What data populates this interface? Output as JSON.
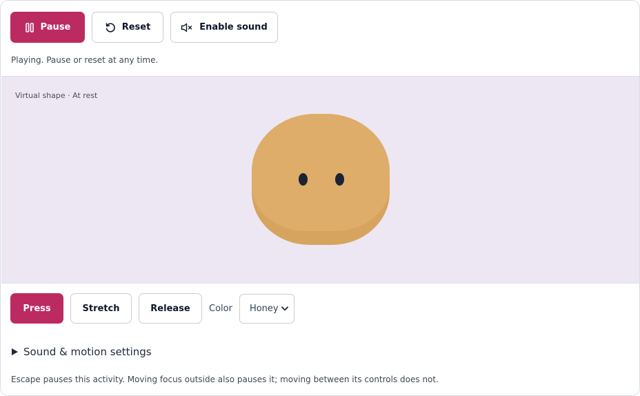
{
  "toolbar": {
    "pause_label": "Pause",
    "reset_label": "Reset",
    "sound_label": "Enable sound"
  },
  "status": "Playing. Pause or reset at any time.",
  "stage": {
    "caption": "Virtual shape · At rest",
    "shape_color": "#d6a45e"
  },
  "actions": {
    "press_label": "Press",
    "stretch_label": "Stretch",
    "release_label": "Release",
    "color_label": "Color",
    "color_selected": "Honey"
  },
  "settings": {
    "summary_label": "Sound & motion settings"
  },
  "help": "Escape pauses this activity. Moving focus outside also pauses it; moving between its controls does not.",
  "colors": {
    "accent": "#bc2a62",
    "stage_bg": "#ede7f3"
  },
  "icons": [
    "pause-icon",
    "reset-icon",
    "sound-muted-icon",
    "chevron-down-icon",
    "disclosure-triangle-icon"
  ]
}
